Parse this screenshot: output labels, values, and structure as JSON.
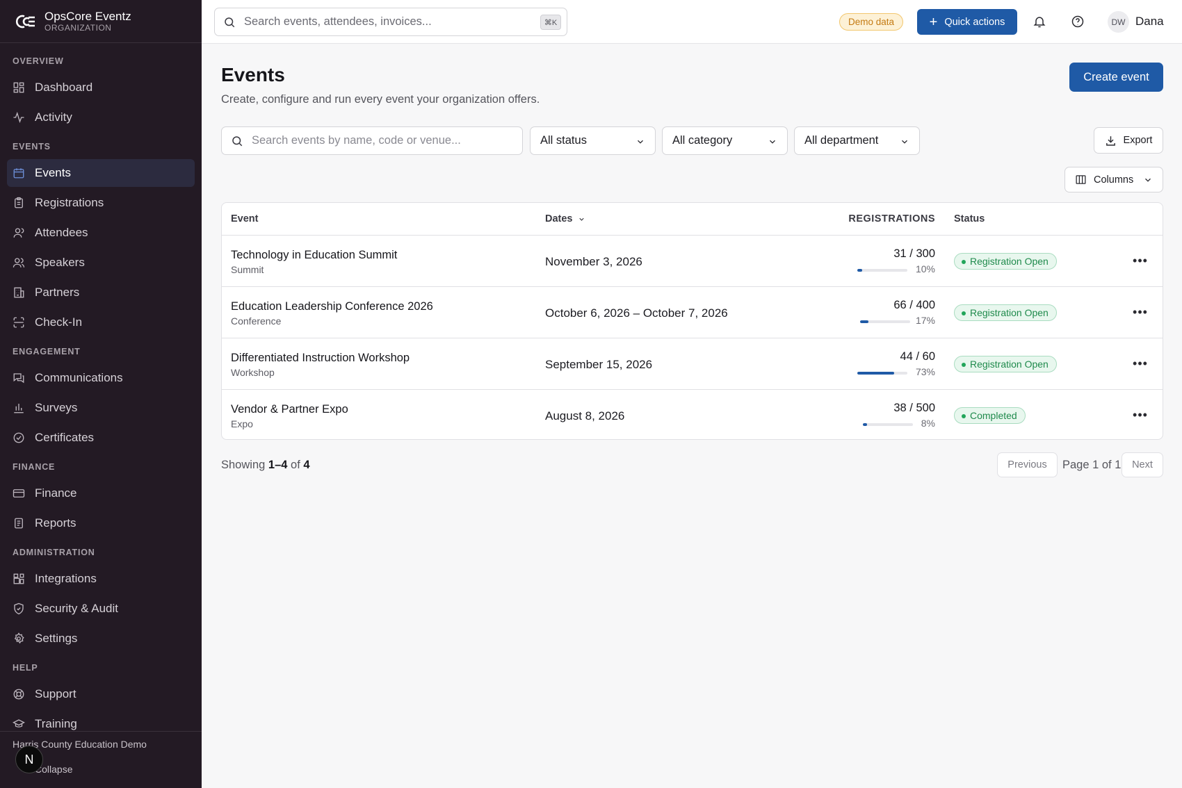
{
  "brand": {
    "name": "OpsCore Eventz",
    "subtitle": "ORGANIZATION"
  },
  "sidebar": {
    "sections": [
      {
        "title": "OVERVIEW",
        "items": [
          {
            "label": "Dashboard",
            "icon": "dashboard-icon"
          },
          {
            "label": "Activity",
            "icon": "activity-icon"
          }
        ]
      },
      {
        "title": "EVENTS",
        "items": [
          {
            "label": "Events",
            "icon": "calendar-icon",
            "active": true
          },
          {
            "label": "Registrations",
            "icon": "clipboard-icon"
          },
          {
            "label": "Attendees",
            "icon": "user-icon"
          },
          {
            "label": "Speakers",
            "icon": "users-icon"
          },
          {
            "label": "Partners",
            "icon": "building-icon"
          },
          {
            "label": "Check-In",
            "icon": "scan-icon"
          }
        ]
      },
      {
        "title": "ENGAGEMENT",
        "items": [
          {
            "label": "Communications",
            "icon": "messages-icon"
          },
          {
            "label": "Surveys",
            "icon": "bar-chart-icon"
          },
          {
            "label": "Certificates",
            "icon": "check-circle-icon"
          }
        ]
      },
      {
        "title": "FINANCE",
        "items": [
          {
            "label": "Finance",
            "icon": "credit-card-icon"
          },
          {
            "label": "Reports",
            "icon": "report-icon"
          }
        ]
      },
      {
        "title": "ADMINISTRATION",
        "items": [
          {
            "label": "Integrations",
            "icon": "puzzle-icon"
          },
          {
            "label": "Security & Audit",
            "icon": "shield-icon"
          },
          {
            "label": "Settings",
            "icon": "gear-icon"
          }
        ]
      },
      {
        "title": "HELP",
        "items": [
          {
            "label": "Support",
            "icon": "lifebuoy-icon"
          },
          {
            "label": "Training",
            "icon": "graduation-cap-icon"
          }
        ]
      }
    ],
    "footer": {
      "org_name": "Harris County Education Demo",
      "collapse_label": "Collapse",
      "badge": "N"
    }
  },
  "topbar": {
    "search_placeholder": "Search events, attendees, invoices...",
    "shortcut": "⌘K",
    "demo_badge": "Demo data",
    "quick_actions_label": "Quick actions",
    "user_initials": "DW",
    "user_name": "Dana"
  },
  "page": {
    "title": "Events",
    "description": "Create, configure and run every event your organization offers.",
    "create_label": "Create event"
  },
  "filters": {
    "search_placeholder": "Search events by name, code or venue...",
    "status": "All status",
    "category": "All category",
    "department": "All department",
    "export_label": "Export",
    "columns_label": "Columns"
  },
  "table": {
    "headers": {
      "event": "Event",
      "dates": "Dates",
      "registrations": "REGISTRATIONS",
      "status": "Status"
    },
    "rows": [
      {
        "name": "Technology in Education Summit",
        "category": "Summit",
        "dates": "November 3, 2026",
        "registrations": "31 / 300",
        "percent_label": "10%",
        "fill": 0.1,
        "status": "Registration Open"
      },
      {
        "name": "Education Leadership Conference 2026",
        "category": "Conference",
        "dates": "October 6, 2026 – October 7, 2026",
        "registrations": "66 / 400",
        "percent_label": "17%",
        "fill": 0.17,
        "status": "Registration Open"
      },
      {
        "name": "Differentiated Instruction Workshop",
        "category": "Workshop",
        "dates": "September 15, 2026",
        "registrations": "44 / 60",
        "percent_label": "73%",
        "fill": 0.73,
        "status": "Registration Open"
      },
      {
        "name": "Vendor & Partner Expo",
        "category": "Expo",
        "dates": "August 8, 2026",
        "registrations": "38 / 500",
        "percent_label": "8%",
        "fill": 0.08,
        "status": "Completed"
      }
    ]
  },
  "pagination": {
    "showing_prefix": "Showing",
    "range": "1–4",
    "of_label": "of",
    "total": "4",
    "previous_label": "Previous",
    "page_info": "Page 1 of 1",
    "next_label": "Next"
  },
  "colors": {
    "accent": "#1f5aa6",
    "sidebar_bg": "#231a24",
    "success": "#1f8a4c",
    "warning": "#c47a12"
  }
}
